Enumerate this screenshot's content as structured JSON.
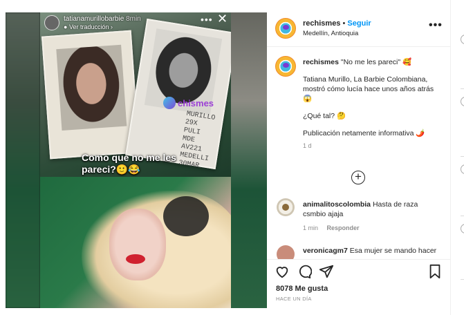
{
  "story": {
    "username": "tatianamurillobarbie",
    "age": "8min",
    "translate": "Ver traducción",
    "caption": "Como que no me les pareci?🙂😂",
    "watermark": "chismes",
    "id_text": "MURILLO 29X PULI MDE AV221 MEDELLI 30MAR"
  },
  "post": {
    "username": "rechismes",
    "separator": "•",
    "follow": "Seguir",
    "location": "Medellín, Antioquia"
  },
  "caption": {
    "username": "rechismes",
    "title": "\"No me les pareci\" 🥰",
    "line1": "Tatiana Murillo, La Barbie Colombiana, mostró cómo lucía hace unos años atrás 😱",
    "line2": "¿Qué tal? 🤔",
    "line3": "Publicación netamente informativa 🌶️",
    "time": "1 d"
  },
  "comments": [
    {
      "username": "animalitoscolombia",
      "text": "Hasta de raza csmbio ajaja",
      "time": "1 min",
      "reply": "Responder"
    },
    {
      "username": "veronicagm7",
      "text": "Esa mujer se mando hacer"
    }
  ],
  "actions": {
    "likes": "8078 Me gusta",
    "date": "HACE UN DÍA"
  },
  "icons": {
    "more": "more-options-icon",
    "like": "heart-icon",
    "comment": "comment-icon",
    "share": "send-icon",
    "save": "bookmark-icon",
    "load": "plus-circle-icon",
    "close": "close-icon"
  }
}
